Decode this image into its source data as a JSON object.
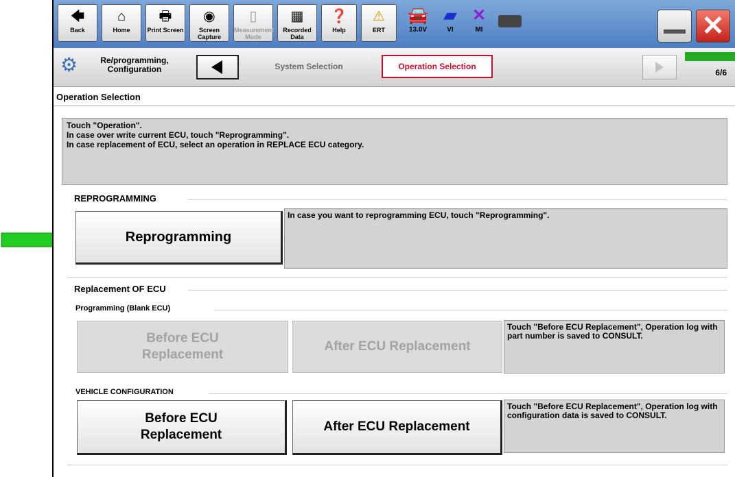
{
  "toolbar": {
    "buttons": [
      {
        "label": "Back",
        "icon": "back-arrow-icon"
      },
      {
        "label": "Home",
        "icon": "home-icon"
      },
      {
        "label": "Print Screen",
        "icon": "printer-icon"
      },
      {
        "label": "Screen Capture",
        "icon": "camera-icon"
      },
      {
        "label": "Measurement Mode",
        "icon": "measurement-icon"
      },
      {
        "label": "Recorded Data",
        "icon": "recorded-data-icon"
      },
      {
        "label": "Help",
        "icon": "help-icon"
      },
      {
        "label": "ERT",
        "icon": "warning-icon"
      }
    ],
    "status": [
      {
        "label": "13.0V",
        "icon": "car-icon"
      },
      {
        "label": "VI",
        "icon": "vi-icon"
      },
      {
        "label": "MI",
        "icon": "mi-icon"
      }
    ]
  },
  "nav": {
    "crumb_label": "Re/programming, Configuration",
    "steps": [
      "System Selection",
      "Operation Selection"
    ],
    "progress_text": "6/6",
    "progress_fraction": 1.0
  },
  "page": {
    "title": "Operation Selection",
    "info_lines": [
      "Touch \"Operation\".",
      "In case over write current ECU, touch \"Reprogramming\".",
      "In case replacement of ECU, select an operation in REPLACE ECU category."
    ]
  },
  "reprogramming": {
    "group_title": "REPROGRAMMING",
    "button_label": "Reprogramming",
    "description": "In case you want to reprogramming ECU, touch \"Reprogramming\"."
  },
  "replacement": {
    "group_title": "Replacement OF ECU",
    "blank": {
      "title": "Programming (Blank ECU)",
      "before_label": "Before ECU Replacement",
      "after_label": "After ECU Replacement",
      "description": "Touch \"Before ECU Replacement\", Operation log with part number is saved to CONSULT."
    },
    "vehicle": {
      "title": "VEHICLE CONFIGURATION",
      "before_label": "Before ECU Replacement",
      "after_label": "After ECU Replacement",
      "description": "Touch \"Before ECU Replacement\", Operation log with configuration data is saved to CONSULT."
    }
  },
  "colors": {
    "arrow": "#22cc22",
    "current_step": "#c0102c",
    "progress": "#22aa22"
  }
}
